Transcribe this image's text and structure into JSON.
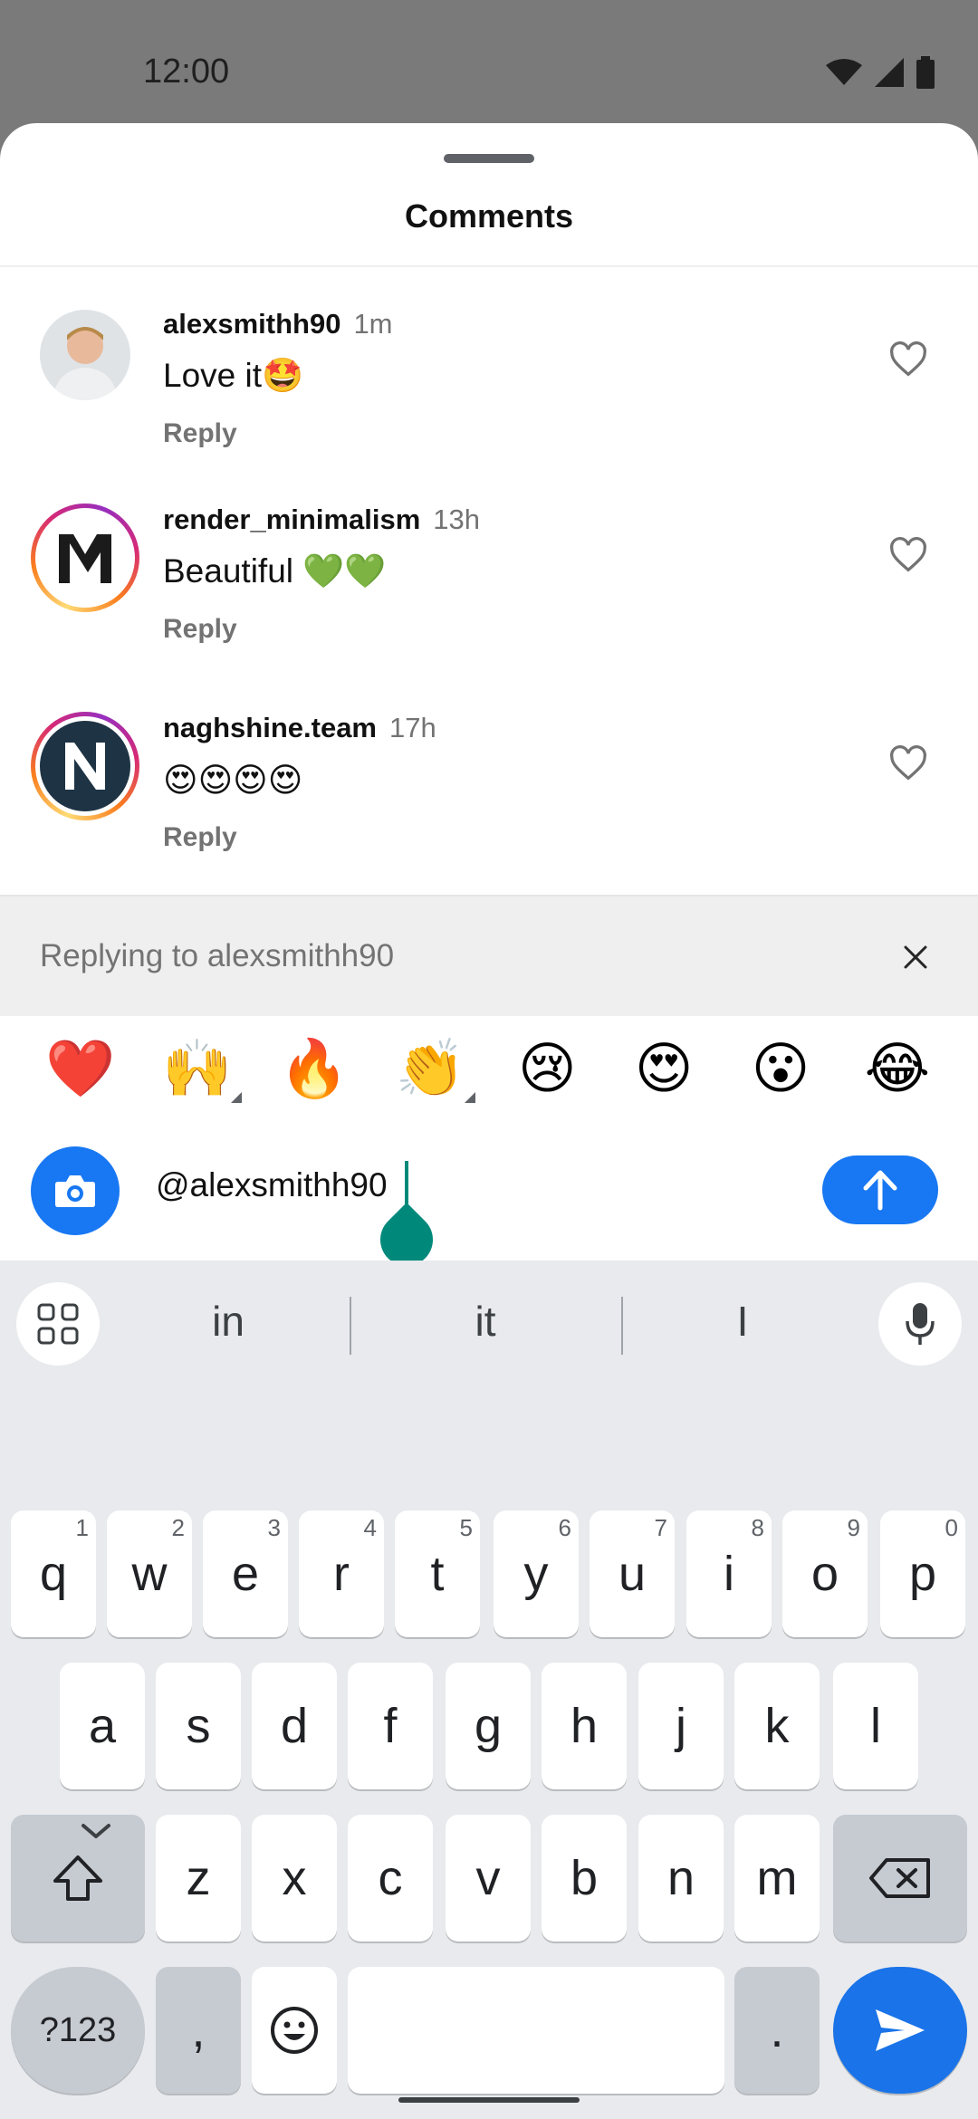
{
  "status_bar": {
    "time": "12:00"
  },
  "sheet": {
    "title": "Comments"
  },
  "comments": [
    {
      "username": "alexsmithh90",
      "time": "1m",
      "text": "Love it🤩",
      "reply_label": "Reply"
    },
    {
      "username": "render_minimalism",
      "time": "13h",
      "text": "Beautiful 💚💚",
      "reply_label": "Reply"
    },
    {
      "username": "naghshine.team",
      "time": "17h",
      "text": "😍😍😍😍",
      "reply_label": "Reply"
    }
  ],
  "replying": {
    "text": "Replying to alexsmithh90"
  },
  "quick_emojis": [
    "❤️",
    "🙌",
    "🔥",
    "👏",
    "😢",
    "😍",
    "😮",
    "😂"
  ],
  "composer": {
    "value": "@alexsmithh90"
  },
  "keyboard": {
    "suggestions": [
      "in",
      "it",
      "I"
    ],
    "row1": [
      {
        "k": "q",
        "n": "1"
      },
      {
        "k": "w",
        "n": "2"
      },
      {
        "k": "e",
        "n": "3"
      },
      {
        "k": "r",
        "n": "4"
      },
      {
        "k": "t",
        "n": "5"
      },
      {
        "k": "y",
        "n": "6"
      },
      {
        "k": "u",
        "n": "7"
      },
      {
        "k": "i",
        "n": "8"
      },
      {
        "k": "o",
        "n": "9"
      },
      {
        "k": "p",
        "n": "0"
      }
    ],
    "row2": [
      "a",
      "s",
      "d",
      "f",
      "g",
      "h",
      "j",
      "k",
      "l"
    ],
    "row3": [
      "z",
      "x",
      "c",
      "v",
      "b",
      "n",
      "m"
    ],
    "symbols_label": "?123",
    "comma": ",",
    "period": "."
  },
  "colors": {
    "accent": "#1877f2",
    "caret": "#00897b",
    "keyboard_bg": "#e8eaed"
  }
}
